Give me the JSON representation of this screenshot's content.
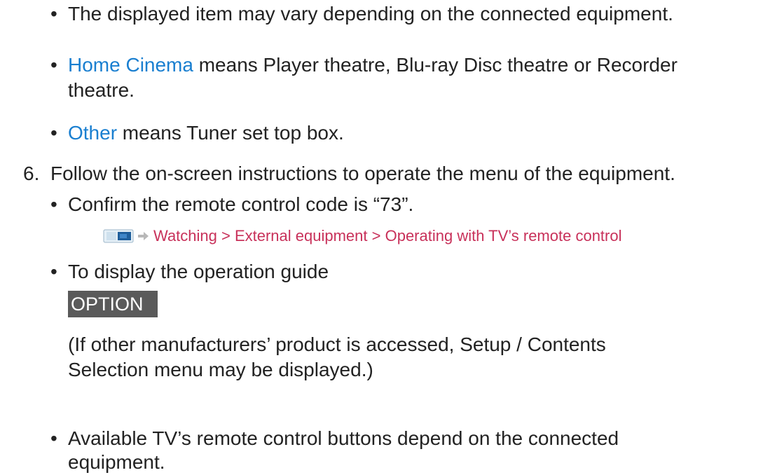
{
  "bullets": {
    "b1": "The displayed item may vary depending on the connected equipment.",
    "b2_term": "Home Cinema",
    "b2_rest": " means Player theatre, Blu-ray Disc theatre or Recorder",
    "b2_cont": "theatre.",
    "b3_term": "Other",
    "b3_rest": " means Tuner set top box."
  },
  "step": {
    "number": "6.",
    "text": "Follow the on-screen instructions to operate the menu of the equipment."
  },
  "sub_bullets": {
    "s1": "Confirm the remote control code is “73”.",
    "link": "Watching > External equipment > Operating with TV’s remote control",
    "s2": "To display the operation guide",
    "option_key": "OPTION",
    "note_line1": "(If other manufacturers’ product is accessed, Setup / Contents",
    "note_line2": "Selection menu may be displayed.)",
    "s3_line1": "Available TV’s remote control buttons depend on the connected",
    "s3_line2": "equipment."
  },
  "icons": {
    "tv": "tv-reference-icon",
    "arrow": "arrow-right-icon"
  },
  "colors": {
    "term": "#1a7fd0",
    "link": "#c8315a",
    "key_bg": "#5a5a5a"
  }
}
